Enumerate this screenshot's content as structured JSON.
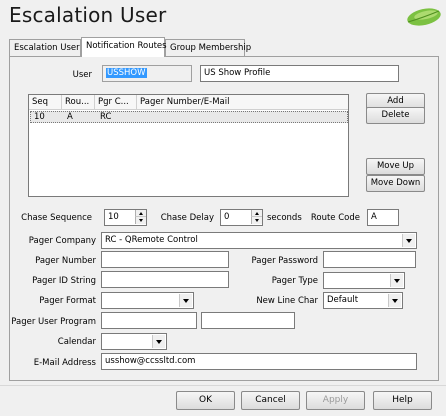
{
  "window": {
    "title": "Escalation User"
  },
  "tabs": [
    "Escalation User",
    "Notification Routes",
    "Group Membership"
  ],
  "user": {
    "label": "User",
    "id": "USSHOW",
    "profile": "US Show Profile"
  },
  "list": {
    "columns": [
      "Seq",
      "Rou...",
      "Pgr C...",
      "Pager Number/E-Mail"
    ],
    "rows": [
      {
        "seq": "10",
        "route": "A",
        "pgr": "RC",
        "number": ""
      }
    ]
  },
  "list_buttons": {
    "add": "Add",
    "delete": "Delete",
    "move_up": "Move Up",
    "move_down": "Move Down"
  },
  "form": {
    "chase_sequence_label": "Chase Sequence",
    "chase_sequence_value": "10",
    "chase_delay_label": "Chase Delay",
    "chase_delay_value": "0",
    "seconds_label": "seconds",
    "route_code_label": "Route Code",
    "route_code_value": "A",
    "pager_company_label": "Pager Company",
    "pager_company_value": "RC - QRemote Control",
    "pager_number_label": "Pager Number",
    "pager_number_value": "",
    "pager_password_label": "Pager Password",
    "pager_password_value": "",
    "pager_id_string_label": "Pager ID String",
    "pager_id_string_value": "",
    "pager_type_label": "Pager Type",
    "pager_type_value": "",
    "pager_format_label": "Pager Format",
    "pager_format_value": "",
    "new_line_char_label": "New Line Char",
    "new_line_char_value": "Default",
    "pager_user_program_label": "Pager User Program",
    "pager_user_program_value": "",
    "pager_user_program_extra": "",
    "calendar_label": "Calendar",
    "calendar_value": "",
    "email_label": "E-Mail Address",
    "email_value": "usshow@ccssltd.com"
  },
  "footer": {
    "ok": "OK",
    "cancel": "Cancel",
    "apply": "Apply",
    "help": "Help"
  },
  "icons": {
    "logo": "leaf-logo-icon"
  }
}
